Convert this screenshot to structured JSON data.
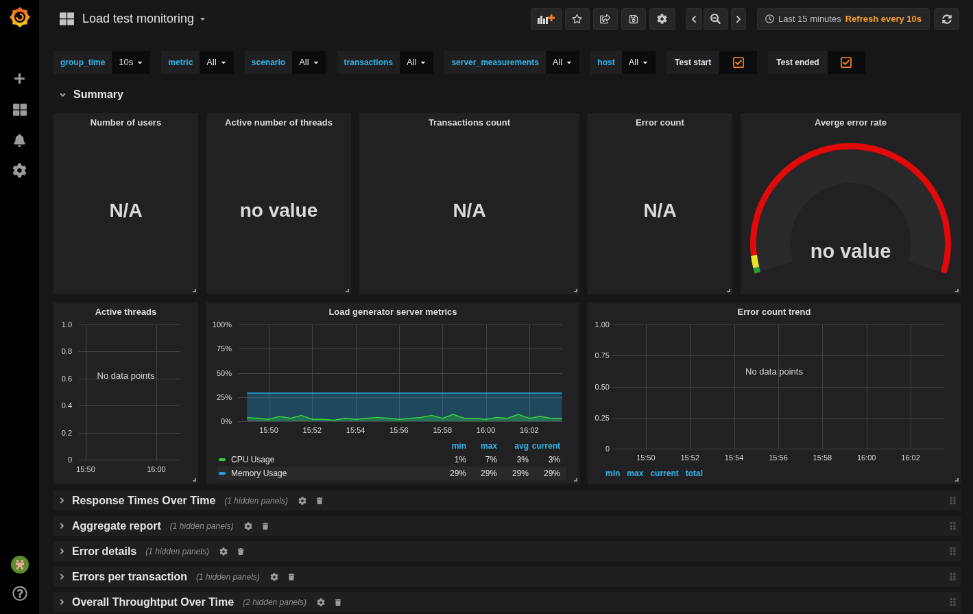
{
  "dashboard": {
    "title": "Load test monitoring"
  },
  "time_picker": {
    "range": "Last 15 minutes",
    "refresh": "Refresh every 10s"
  },
  "variables": [
    {
      "kind": "select",
      "label": "group_time",
      "value": "10s"
    },
    {
      "kind": "select",
      "label": "metric",
      "value": "All"
    },
    {
      "kind": "select",
      "label": "scenario",
      "value": "All"
    },
    {
      "kind": "select",
      "label": "transactions",
      "value": "All"
    },
    {
      "kind": "select",
      "label": "server_measurements",
      "value": "All"
    },
    {
      "kind": "select",
      "label": "host",
      "value": "All"
    },
    {
      "kind": "checkbox",
      "label": "Test start",
      "checked": true
    },
    {
      "kind": "checkbox",
      "label": "Test ended",
      "checked": true
    }
  ],
  "rows": [
    {
      "title": "Summary",
      "expanded": true,
      "stat_panels": [
        {
          "kind": "stat",
          "title": "Number of users",
          "value": "N/A"
        },
        {
          "kind": "stat",
          "title": "Active number of threads",
          "value": "no value"
        },
        {
          "kind": "stat",
          "title": "Transactions count",
          "value": "N/A"
        },
        {
          "kind": "stat",
          "title": "Error count",
          "value": "N/A"
        },
        {
          "kind": "gauge",
          "title": "Averge error rate",
          "value": "no value"
        }
      ],
      "graph_panels": [
        {
          "title": "Active threads",
          "message": "No data points",
          "chart_data": {
            "type": "line",
            "grid": true,
            "categories": [
              null,
              "15:50",
              null,
              null,
              null,
              null,
              null,
              null,
              null,
              null,
              null,
              "16:00",
              null,
              null,
              null
            ],
            "ylim": [
              0,
              1
            ],
            "yticks": [
              0,
              0.2,
              0.4,
              0.6,
              0.8,
              {
                "value": 1,
                "label": "1.0"
              }
            ]
          }
        },
        {
          "title": "Load generator server metrics",
          "chart_data": {
            "type": "area",
            "grid": true,
            "categories": [
              null,
              null,
              "15:50",
              null,
              null,
              null,
              "15:52",
              null,
              null,
              null,
              "15:54",
              null,
              null,
              null,
              "15:56",
              null,
              null,
              null,
              "15:58",
              null,
              null,
              null,
              "16:00",
              null,
              null,
              null,
              "16:02",
              null,
              null,
              null
            ],
            "series": [
              {
                "name": "CPU Usage",
                "color": "#33d43e",
                "values": [
                  4,
                  3,
                  2,
                  5,
                  3,
                  6,
                  2,
                  2,
                  1,
                  3,
                  2,
                  3,
                  4,
                  3,
                  2,
                  3,
                  4,
                  6,
                  3,
                  7,
                  3,
                  3,
                  2,
                  4,
                  3,
                  7,
                  3,
                  5,
                  3,
                  3
                ]
              },
              {
                "name": "Memory Usage",
                "color": "#1fa3e0",
                "values": [
                  29,
                  29,
                  29,
                  29,
                  29,
                  29,
                  29,
                  29,
                  29,
                  29,
                  29,
                  29,
                  29,
                  29,
                  29,
                  29,
                  29,
                  29,
                  29,
                  29,
                  29,
                  29,
                  29,
                  29,
                  29,
                  29,
                  29,
                  29,
                  29,
                  29
                ]
              }
            ],
            "ylim": [
              0,
              100
            ],
            "yticks": [
              {
                "value": 0,
                "label": "0%"
              },
              {
                "value": 25,
                "label": "25%"
              },
              {
                "value": 50,
                "label": "50%"
              },
              {
                "value": 75,
                "label": "75%"
              },
              {
                "value": 100,
                "label": "100%"
              }
            ]
          },
          "legend": {
            "columns": [
              "min",
              "max",
              "avg",
              "current"
            ],
            "rows": [
              {
                "values": [
                  "1%",
                  "7%",
                  "3%",
                  "3%"
                ],
                "highlighted": false
              },
              {
                "values": [
                  "29%",
                  "29%",
                  "29%",
                  "29%"
                ],
                "highlighted": true
              }
            ]
          }
        },
        {
          "title": "Error count trend",
          "message": "No data points",
          "chart_data": {
            "type": "line",
            "grid": true,
            "categories": [
              null,
              "15:50",
              null,
              "15:52",
              null,
              "15:54",
              null,
              "15:56",
              null,
              "15:58",
              null,
              "16:00",
              null,
              "16:02",
              null
            ],
            "ylim": [
              0,
              1
            ],
            "yticks": [
              0,
              0.25,
              {
                "value": 0.5,
                "label": "0.50"
              },
              0.75,
              {
                "value": 1,
                "label": "1.00"
              }
            ]
          },
          "legend": {
            "columns": [
              "min",
              "max",
              "current",
              "total"
            ]
          }
        }
      ]
    },
    {
      "title": "Response Times Over Time",
      "expanded": false,
      "hidden_panels": "(1 hidden panels)"
    },
    {
      "title": "Aggregate report",
      "expanded": false,
      "hidden_panels": "(1 hidden panels)"
    },
    {
      "title": "Error details",
      "expanded": false,
      "hidden_panels": "(1 hidden panels)"
    },
    {
      "title": "Errors per transaction",
      "expanded": false,
      "hidden_panels": "(1 hidden panels)"
    },
    {
      "title": "Overall Throughtput Over Time",
      "expanded": false,
      "hidden_panels": "(2 hidden panels)"
    }
  ]
}
